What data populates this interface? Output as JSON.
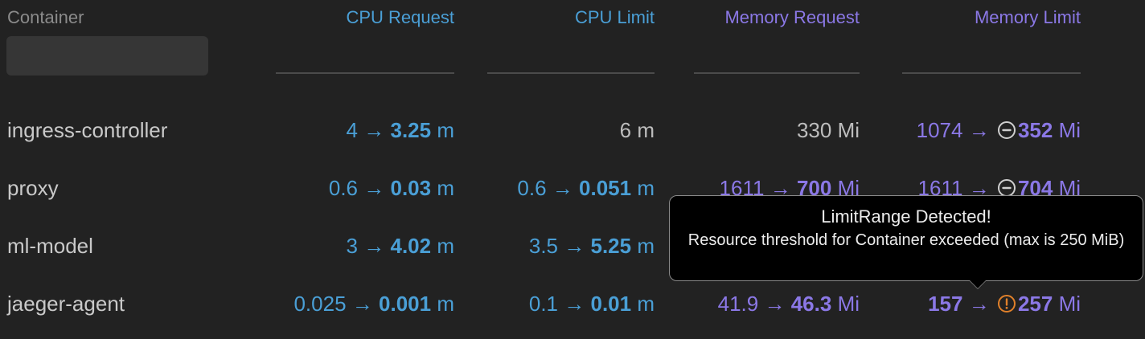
{
  "headers": {
    "container": "Container",
    "cpu_request": "CPU Request",
    "cpu_limit": "CPU Limit",
    "memory_request": "Memory Request",
    "memory_limit": "Memory Limit"
  },
  "filter": {
    "value": "",
    "placeholder": ""
  },
  "colors": {
    "background": "#222222",
    "cpu": "#4a9fd6",
    "memory": "#8b78e6",
    "warning": "#e0802a",
    "neutral": "#bdbdbd"
  },
  "rows": [
    {
      "name": "ingress-controller",
      "cpu_request": {
        "from": "4",
        "arrow": "→",
        "to": "3.25",
        "unit": "m"
      },
      "cpu_limit": {
        "value": "6",
        "unit": "m"
      },
      "memory_request": {
        "value": "330",
        "unit": "Mi"
      },
      "memory_limit": {
        "from": "1074",
        "arrow": "→",
        "icon": "minus-circle-icon",
        "to": "352",
        "unit": "Mi"
      }
    },
    {
      "name": "proxy",
      "cpu_request": {
        "from": "0.6",
        "arrow": "→",
        "to": "0.03",
        "unit": "m"
      },
      "cpu_limit": {
        "from": "0.6",
        "arrow": "→",
        "to": "0.051",
        "unit": "m"
      },
      "memory_request": {
        "from": "1611",
        "arrow": "→",
        "to": "700",
        "unit": "Mi"
      },
      "memory_limit": {
        "from": "1611",
        "arrow": "→",
        "icon": "minus-circle-icon",
        "to": "704",
        "unit": "Mi"
      }
    },
    {
      "name": "ml-model",
      "cpu_request": {
        "from": "3",
        "arrow": "→",
        "to": "4.02",
        "unit": "m"
      },
      "cpu_limit": {
        "from": "3.5",
        "arrow": "→",
        "to": "5.25",
        "unit": "m"
      }
    },
    {
      "name": "jaeger-agent",
      "cpu_request": {
        "from": "0.025",
        "arrow": "→",
        "to": "0.001",
        "unit": "m"
      },
      "cpu_limit": {
        "from": "0.1",
        "arrow": "→",
        "to": "0.01",
        "unit": "m"
      },
      "memory_request": {
        "from": "41.9",
        "arrow": "→",
        "to": "46.3",
        "unit": "Mi"
      },
      "memory_limit": {
        "from": "157",
        "arrow": "→",
        "icon": "warning-circle-icon",
        "to": "257",
        "unit": "Mi"
      }
    }
  ],
  "tooltip": {
    "title": "LimitRange Detected!",
    "body": "Resource threshold for Container exceeded (max is 250 MiB)"
  }
}
